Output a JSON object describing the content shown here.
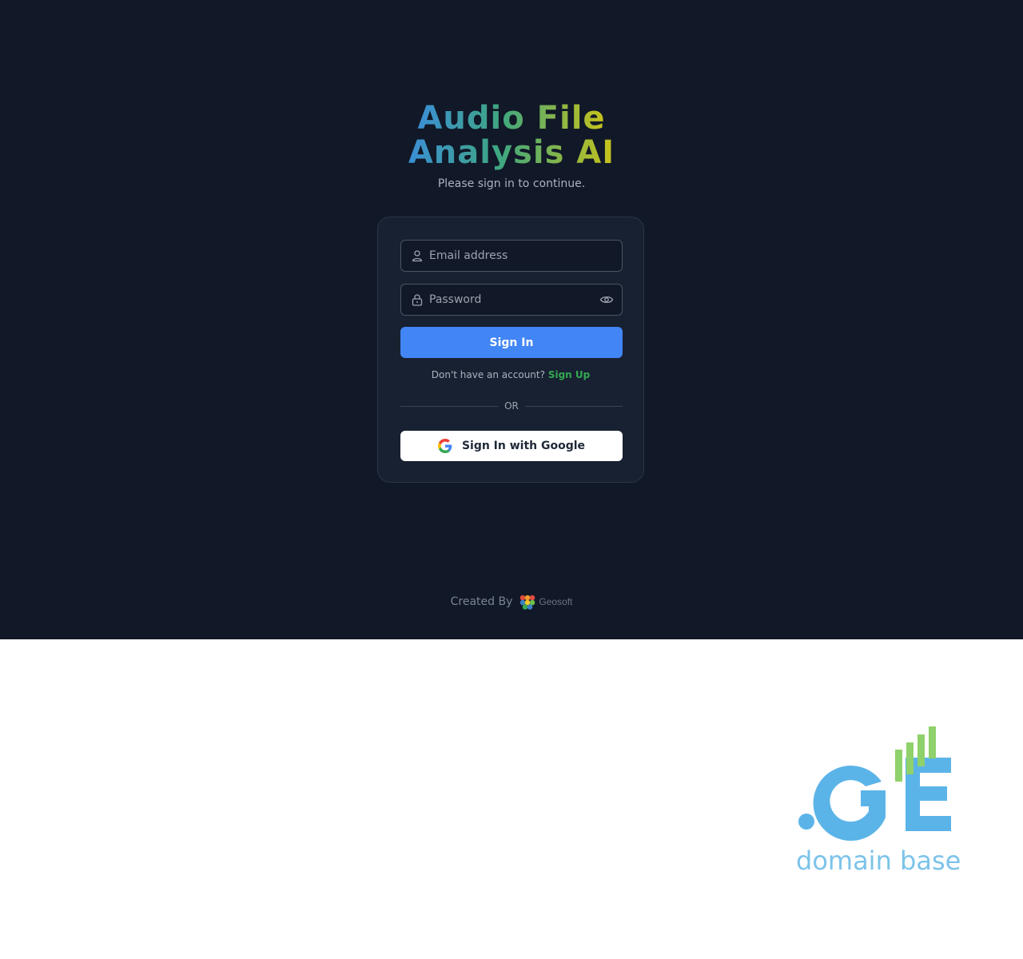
{
  "app": {
    "title_line1": "Audio File",
    "title_line2": "Analysis AI",
    "subtitle": "Please sign in to continue."
  },
  "form": {
    "email_placeholder": "Email address",
    "email_value": "",
    "password_placeholder": "Password",
    "password_value": "",
    "sign_in_label": "Sign In",
    "no_account_text": "Don't have an account?",
    "sign_up_label": "Sign Up",
    "or_text": "OR",
    "google_label": "Sign In with Google"
  },
  "footer": {
    "created_by": "Created By",
    "brand": "Geosoft"
  },
  "watermark": {
    "logo_text": ".GE",
    "tagline": "domain base"
  },
  "icons": {
    "email": "user-icon",
    "password": "lock-icon",
    "toggle": "eye-icon",
    "google": "google-icon",
    "brand": "geosoft-logo-icon"
  },
  "colors": {
    "background": "#111827",
    "card": "#182131",
    "primary": "#4285f4",
    "signup_link": "#34a853",
    "watermark": "#5bb4e8",
    "watermark_bars": "#8fd16a"
  }
}
